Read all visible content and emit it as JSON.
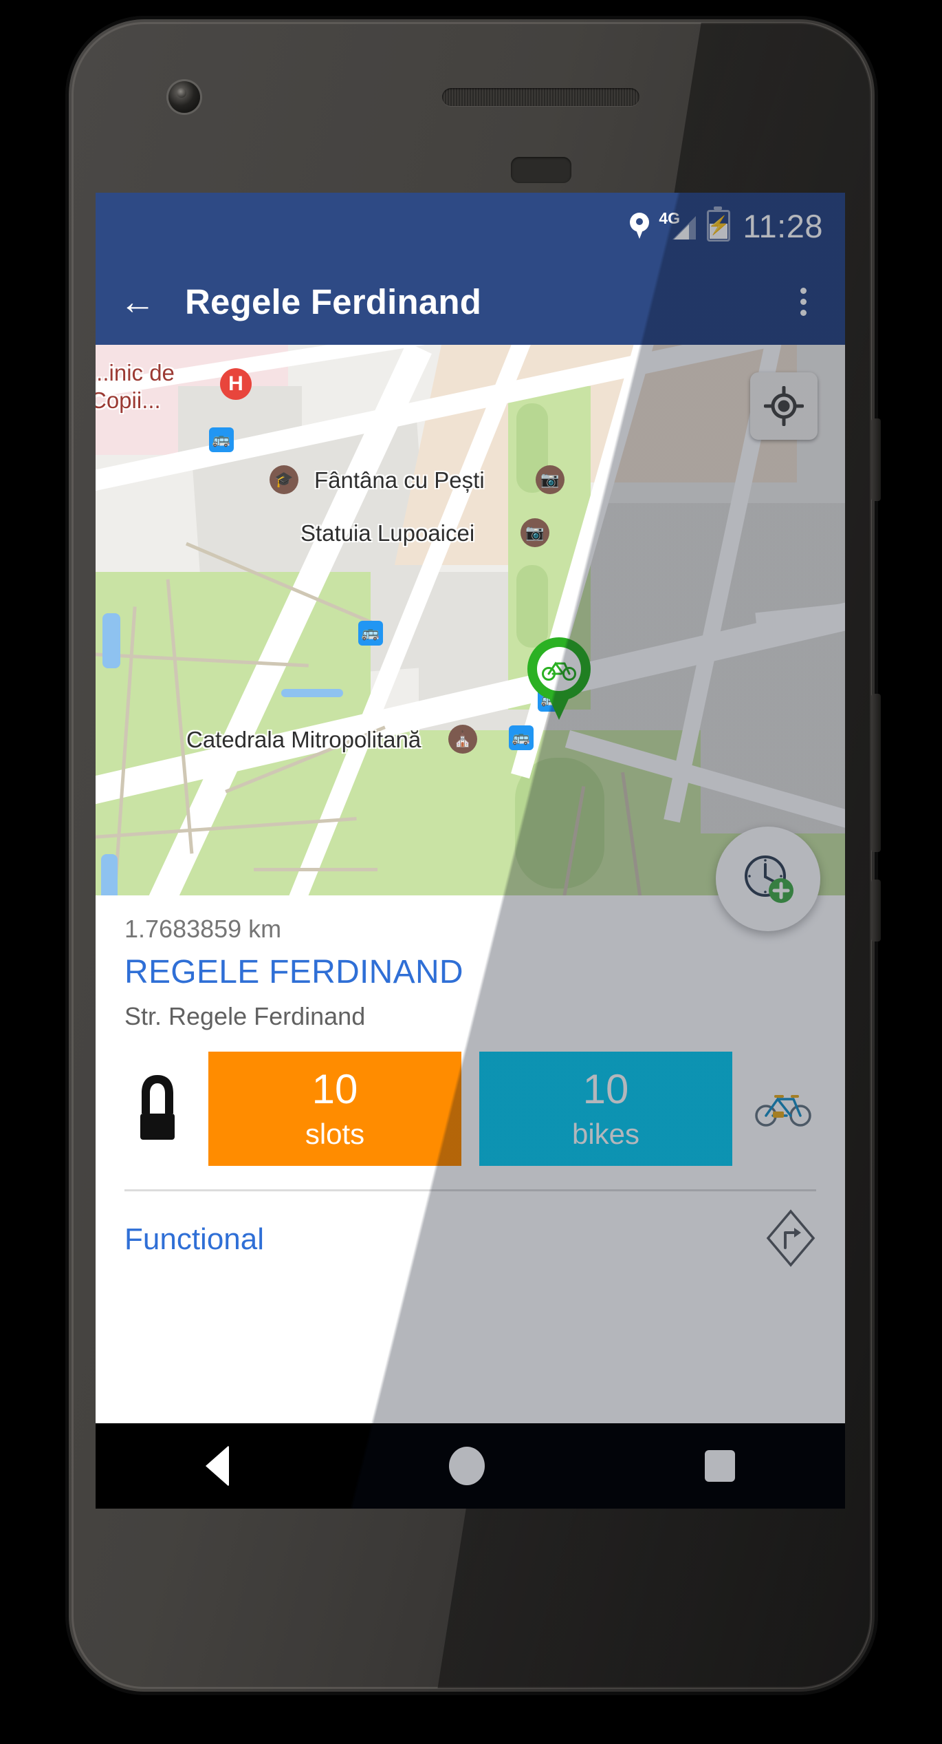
{
  "statusbar": {
    "time": "11:28",
    "network": "4G",
    "icons": [
      "location-pin-icon",
      "signal-4g-icon",
      "battery-charging-icon"
    ]
  },
  "appbar": {
    "back_icon": "back-arrow-icon",
    "title": "Regele Ferdinand",
    "overflow_icon": "overflow-menu-icon"
  },
  "map": {
    "my_location_icon": "my-location-icon",
    "station_marker_icon": "bicycle-pin-icon",
    "labels": [
      {
        "text": "...inic de",
        "icon": ""
      },
      {
        "text": "Copii...",
        "icon": "hospital-h-icon"
      },
      {
        "text": "Fântâna cu Pești",
        "icon": "photo-poi-icon"
      },
      {
        "text": "Statuia Lupoaicei",
        "icon": "photo-poi-icon"
      },
      {
        "text": "Catedrala Mitropolitană",
        "icon": "church-poi-icon"
      }
    ],
    "poi_university_icon": "university-poi-icon",
    "transit_icon": "bus-stop-icon",
    "colors": {
      "park": "#c9e3a4",
      "water": "#8ec2f0",
      "road": "#ffffff",
      "building": "#e2e1dd",
      "hospital_area": "#f6e2e4",
      "plaza": "#f0e2d2"
    }
  },
  "card": {
    "distance": "1.7683859 km",
    "station_name": "REGELE FERDINAND",
    "address": "Str. Regele Ferdinand",
    "lock_icon": "u-lock-icon",
    "bike_icon": "bicycle-icon",
    "slots": {
      "value": "10",
      "label": "slots",
      "color": "#ff8c00"
    },
    "bikes": {
      "value": "10",
      "label": "bikes",
      "color": "#10cdf2"
    },
    "status": {
      "text": "Functional",
      "color": "#2f6fd6"
    },
    "directions_icon": "directions-turn-right-icon",
    "fab_icon": "clock-add-icon"
  },
  "navbar": {
    "back": "nav-back-icon",
    "home": "nav-home-icon",
    "recents": "nav-recents-icon"
  }
}
